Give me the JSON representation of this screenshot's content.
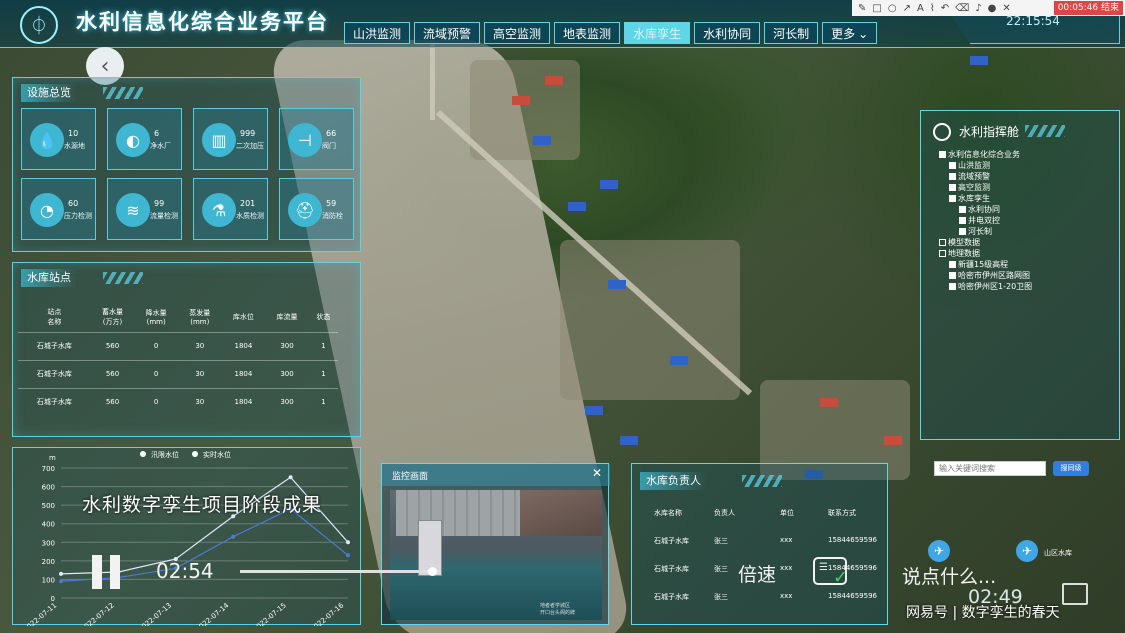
{
  "app": {
    "title": "水利信息化综合业务平台"
  },
  "nav": {
    "tabs": [
      {
        "label": "山洪监测",
        "active": false
      },
      {
        "label": "流域预警",
        "active": false
      },
      {
        "label": "高空监测",
        "active": false
      },
      {
        "label": "地表监测",
        "active": false
      },
      {
        "label": "水库孪生",
        "active": true
      },
      {
        "label": "水利协同",
        "active": false
      },
      {
        "label": "河长制",
        "active": false
      },
      {
        "label": "更多",
        "active": false
      }
    ],
    "clock": "22:15:54"
  },
  "recorder": {
    "badge": "00:05:46 结束"
  },
  "facilities": {
    "title": "设施总览",
    "items": [
      {
        "value": "10",
        "name": "水源地",
        "icon": "water-drop-icon"
      },
      {
        "value": "6",
        "name": "净水厂",
        "icon": "cycle-icon"
      },
      {
        "value": "999",
        "name": "二次加压",
        "icon": "tank-icon"
      },
      {
        "value": "66",
        "name": "阀门",
        "icon": "valve-icon"
      },
      {
        "value": "60",
        "name": "压力检测",
        "icon": "gauge-icon"
      },
      {
        "value": "99",
        "name": "流量检测",
        "icon": "wave-icon"
      },
      {
        "value": "201",
        "name": "水质检测",
        "icon": "flask-icon"
      },
      {
        "value": "59",
        "name": "消防栓",
        "icon": "hydrant-icon"
      }
    ]
  },
  "reservoirs": {
    "title": "水库站点",
    "headers": [
      "站点\n名称",
      "蓄水量\n(万方)",
      "降水量\n(mm)",
      "蒸发量\n(mm)",
      "库水位",
      "库流量",
      "状态"
    ],
    "rows": [
      [
        "石城子水库",
        "560",
        "0",
        "30",
        "1804",
        "300",
        "1"
      ],
      [
        "石城子水库",
        "560",
        "0",
        "30",
        "1804",
        "300",
        "1"
      ],
      [
        "石城子水库",
        "560",
        "0",
        "30",
        "1804",
        "300",
        "1"
      ]
    ]
  },
  "chart_data": {
    "type": "line",
    "title": "",
    "ylabel": "m",
    "ylim": [
      0,
      700
    ],
    "yticks": [
      0,
      100,
      200,
      300,
      400,
      500,
      600,
      700
    ],
    "x": [
      "2022-07-11",
      "2022-07-12",
      "2022-07-13",
      "2022-07-14",
      "2022-07-15",
      "2022-07-16"
    ],
    "series": [
      {
        "name": "汛限水位",
        "values": [
          130,
          140,
          210,
          440,
          650,
          300
        ],
        "color": "#dfe8ff"
      },
      {
        "name": "实时水位",
        "values": [
          90,
          110,
          160,
          330,
          480,
          230
        ],
        "color": "#4a7bd8"
      }
    ]
  },
  "monitor": {
    "title": "监控画面",
    "close": "✕",
    "caption": "地者者学城区\n开口台头阁的牌"
  },
  "responsible": {
    "title": "水库负责人",
    "headers": [
      "水库名称",
      "负责人",
      "单位",
      "联系方式"
    ],
    "rows": [
      [
        "石城子水库",
        "张三",
        "xxx",
        "15844659596"
      ],
      [
        "石城子水库",
        "张三",
        "xxx",
        "15844659596"
      ],
      [
        "石城子水库",
        "张三",
        "xxx",
        "15844659596"
      ]
    ]
  },
  "command": {
    "title": "水利指挥舱",
    "tree": [
      {
        "text": "水利信息化综合业务",
        "level": 0,
        "on": true
      },
      {
        "text": "山洪监测",
        "level": 1,
        "on": true
      },
      {
        "text": "流域预警",
        "level": 1,
        "on": true
      },
      {
        "text": "高空监测",
        "level": 1,
        "on": true
      },
      {
        "text": "水库孪生",
        "level": 1,
        "on": true
      },
      {
        "text": "水利协同",
        "level": 2,
        "on": true
      },
      {
        "text": "井电双控",
        "level": 2,
        "on": true
      },
      {
        "text": "河长制",
        "level": 2,
        "on": true
      },
      {
        "text": "模型数据",
        "level": 0,
        "on": false
      },
      {
        "text": "地理数据",
        "level": 0,
        "on": false
      },
      {
        "text": "新疆15级高程",
        "level": 1,
        "on": true
      },
      {
        "text": "哈密市伊州区路网图",
        "level": 1,
        "on": true
      },
      {
        "text": "哈密伊州区1-20卫图",
        "level": 1,
        "on": true
      }
    ],
    "search_placeholder": "输入关键词搜索",
    "search_button": "搜同级"
  },
  "map_labels": {
    "reservoir": "山区水库"
  },
  "player": {
    "subtitle": "水利数字孪生项目阶段成果",
    "current_time": "02:54",
    "progress": 0.97,
    "speed": "倍速",
    "danmaku_placeholder": "说点什么...",
    "end_time": "02:49"
  },
  "watermark": "网易号 | 数字孪生的春天"
}
